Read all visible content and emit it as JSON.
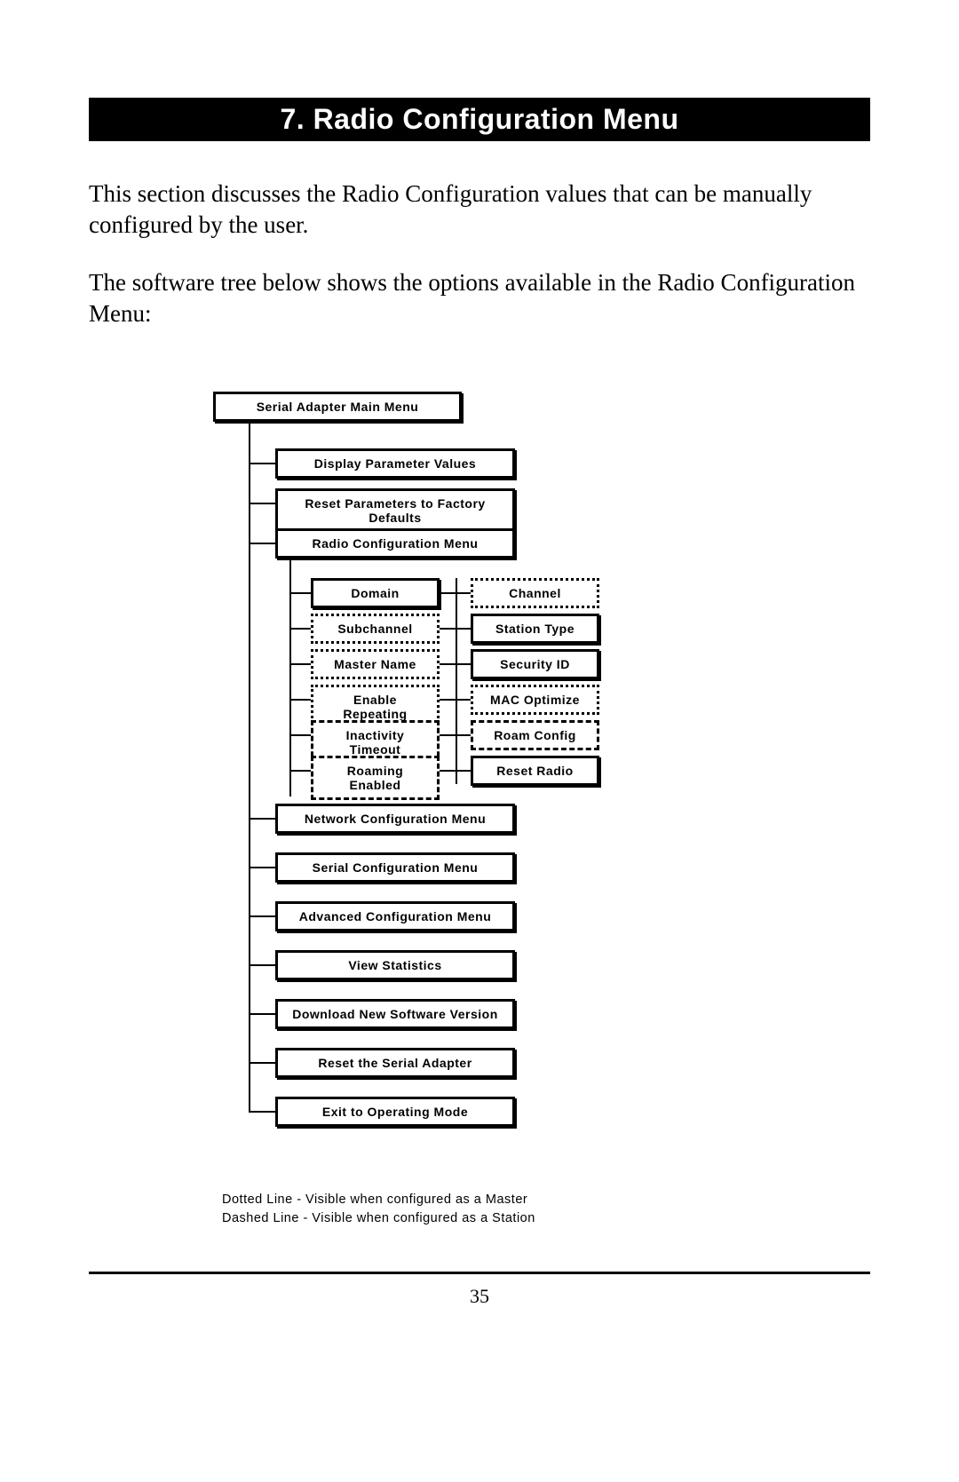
{
  "heading": "7. Radio Configuration Menu",
  "para1": "This section discusses the Radio Configuration values that can be manually configured by the user.",
  "para2": "The software tree below shows the options available in the Radio Configuration Menu:",
  "tree": {
    "root": "Serial Adapter Main Menu",
    "level1": {
      "display": "Display Parameter Values",
      "reset": "Reset Parameters to Factory Defaults",
      "radio": "Radio Configuration Menu",
      "network": "Network Configuration Menu",
      "serial": "Serial Configuration Menu",
      "advanced": "Advanced Configuration Menu",
      "stats": "View Statistics",
      "download": "Download New Software Version",
      "resetAdapter": "Reset the Serial Adapter",
      "exit": "Exit to Operating Mode"
    },
    "radioPairs": {
      "l0": "Domain",
      "r0": "Channel",
      "l1": "Subchannel",
      "r1": "Station Type",
      "l2": "Master Name",
      "r2": "Security ID",
      "l3": "Enable Repeating",
      "r3": "MAC Optimize",
      "l4": "Inactivity Timeout",
      "r4": "Roam Config",
      "l5": "Roaming Enabled",
      "r5": "Reset Radio"
    }
  },
  "legend": {
    "dotted": "Dotted Line - Visible when configured as a Master",
    "dashed": "Dashed Line - Visible when configured as a Station"
  },
  "pageNumber": "35"
}
